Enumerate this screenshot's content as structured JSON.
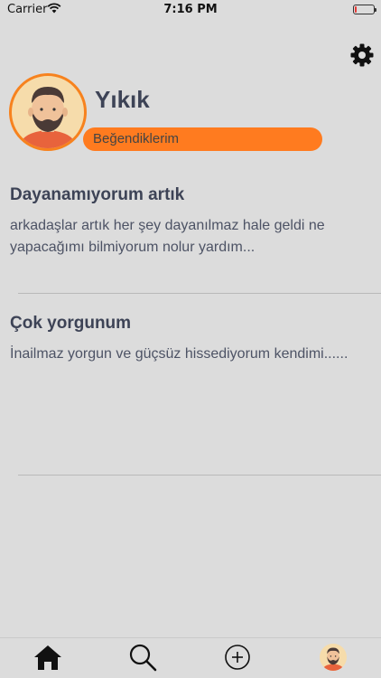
{
  "status_bar": {
    "carrier": "Carrier",
    "time": "7:16 PM",
    "battery_level": 0.12
  },
  "profile": {
    "username": "Yıkık",
    "likes_label": "Beğendiklerim"
  },
  "posts": [
    {
      "title": "Dayanamıyorum artık",
      "body": "arkadaşlar artık her şey dayanılmaz hale geldi ne yapacağımı bilmiyorum nolur yardım..."
    },
    {
      "title": "Çok yorgunum",
      "body": "İnailmaz yorgun ve güçsüz hissediyorum kendimi......"
    }
  ],
  "tab_bar": {
    "items": [
      "home-icon",
      "search-icon",
      "add-icon",
      "profile-avatar"
    ]
  },
  "colors": {
    "accent": "#ff7b1f",
    "background": "#dcdcdc",
    "text": "#3d4356"
  }
}
